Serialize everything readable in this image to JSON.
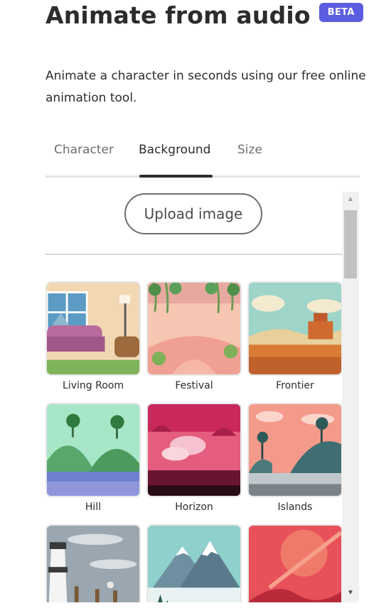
{
  "header": {
    "title": "Animate from audio",
    "badge": "BETA",
    "badge_color": "#5c5ce0",
    "subtitle": "Animate a character in seconds using our free online animation tool."
  },
  "tabs": [
    {
      "label": "Character",
      "active": false
    },
    {
      "label": "Background",
      "active": true
    },
    {
      "label": "Size",
      "active": false
    }
  ],
  "panel": {
    "upload_label": "Upload image",
    "backgrounds": [
      {
        "label": "Living Room",
        "icon": "living-room-thumbnail"
      },
      {
        "label": "Festival",
        "icon": "festival-thumbnail"
      },
      {
        "label": "Frontier",
        "icon": "frontier-thumbnail"
      },
      {
        "label": "Hill",
        "icon": "hill-thumbnail"
      },
      {
        "label": "Horizon",
        "icon": "horizon-thumbnail"
      },
      {
        "label": "Islands",
        "icon": "islands-thumbnail"
      },
      {
        "label": "",
        "icon": "lighthouse-thumbnail"
      },
      {
        "label": "",
        "icon": "mountain-thumbnail"
      },
      {
        "label": "",
        "icon": "red-planet-thumbnail"
      }
    ]
  },
  "scrollbar": {
    "up_icon": "▲",
    "down_icon": "▼"
  }
}
